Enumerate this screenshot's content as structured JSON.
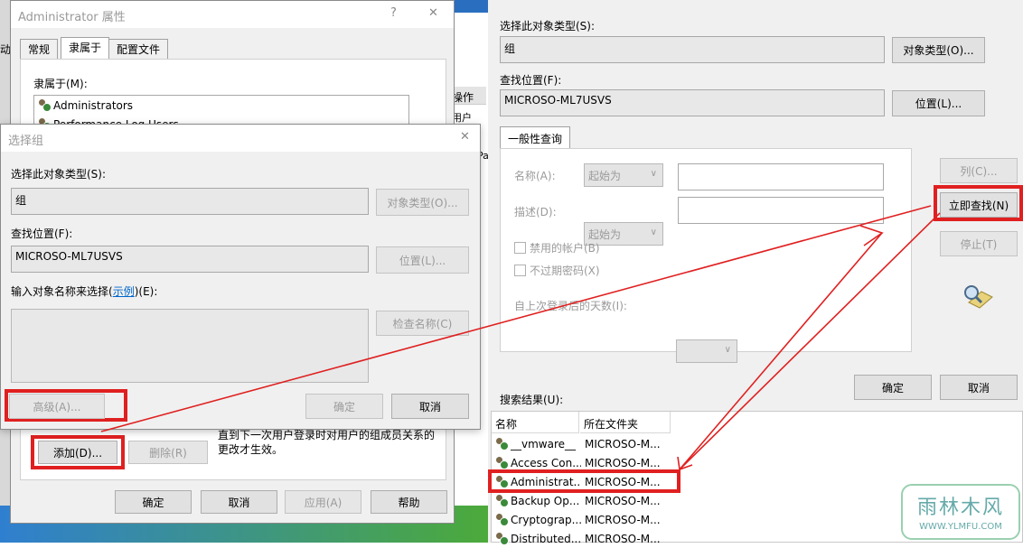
{
  "bg": {
    "menu_left": "动",
    "ops_label": "操作",
    "ops_sub": "用户",
    "side_text": "Pa"
  },
  "admin_props": {
    "title": "Administrator 属性",
    "help_glyph": "?",
    "close_glyph": "✕",
    "tabs": [
      "常规",
      "隶属于",
      "配置文件"
    ],
    "member_of_label": "隶属于(M):",
    "members": [
      "Administrators",
      "Performance Log Users"
    ],
    "add_button": "添加(D)...",
    "remove_button": "删除(R)",
    "note": "直到下一次用户登录时对用户的组成员关系的更改才生效。",
    "ok_button": "确定",
    "cancel_button": "取消",
    "apply_button": "应用(A)",
    "help_button": "帮助"
  },
  "select_group": {
    "title": "选择组",
    "close_glyph": "✕",
    "obj_type_label": "选择此对象类型(S):",
    "obj_type_value": "组",
    "obj_type_button": "对象类型(O)...",
    "location_label": "查找位置(F):",
    "location_value": "MICROSO-ML7USVS",
    "location_button": "位置(L)...",
    "names_label_pre": "输入对象名称来选择(",
    "names_label_link": "示例",
    "names_label_post": ")(E):",
    "check_names_button": "检查名称(C)",
    "advanced_button": "高级(A)...",
    "ok_button": "确定",
    "cancel_button": "取消"
  },
  "advanced": {
    "obj_type_label": "选择此对象类型(S):",
    "obj_type_value": "组",
    "obj_type_button": "对象类型(O)...",
    "location_label": "查找位置(F):",
    "location_value": "MICROSO-ML7USVS",
    "location_button": "位置(L)...",
    "query_tab": "一般性查询",
    "name_label": "名称(A):",
    "name_combo": "起始为",
    "desc_label": "描述(D):",
    "desc_combo": "起始为",
    "disabled_accounts": "禁用的帐户(B)",
    "no_expire_pwd": "不过期密码(X)",
    "days_since_login": "自上次登录后的天数(I):",
    "columns_button": "列(C)...",
    "find_now_button": "立即查找(N)",
    "stop_button": "停止(T)",
    "ok_button": "确定",
    "cancel_button": "取消",
    "results_label": "搜索结果(U):",
    "col_name": "名称",
    "col_folder": "所在文件夹",
    "results": [
      {
        "name": "__vmware__",
        "folder": "MICROSO-M..."
      },
      {
        "name": "Access Con...",
        "folder": "MICROSO-M..."
      },
      {
        "name": "Administrat...",
        "folder": "MICROSO-M..."
      },
      {
        "name": "Backup Op...",
        "folder": "MICROSO-M..."
      },
      {
        "name": "Cryptograp...",
        "folder": "MICROSO-M..."
      },
      {
        "name": "Distributed...",
        "folder": "MICROSO-M..."
      }
    ]
  },
  "watermark": {
    "brand": "雨林木风",
    "url": "WWW.YLMFU.COM"
  },
  "colors": {
    "highlight": "#e02020",
    "disabled_text": "#9a9a9a",
    "link": "#0066cc"
  }
}
